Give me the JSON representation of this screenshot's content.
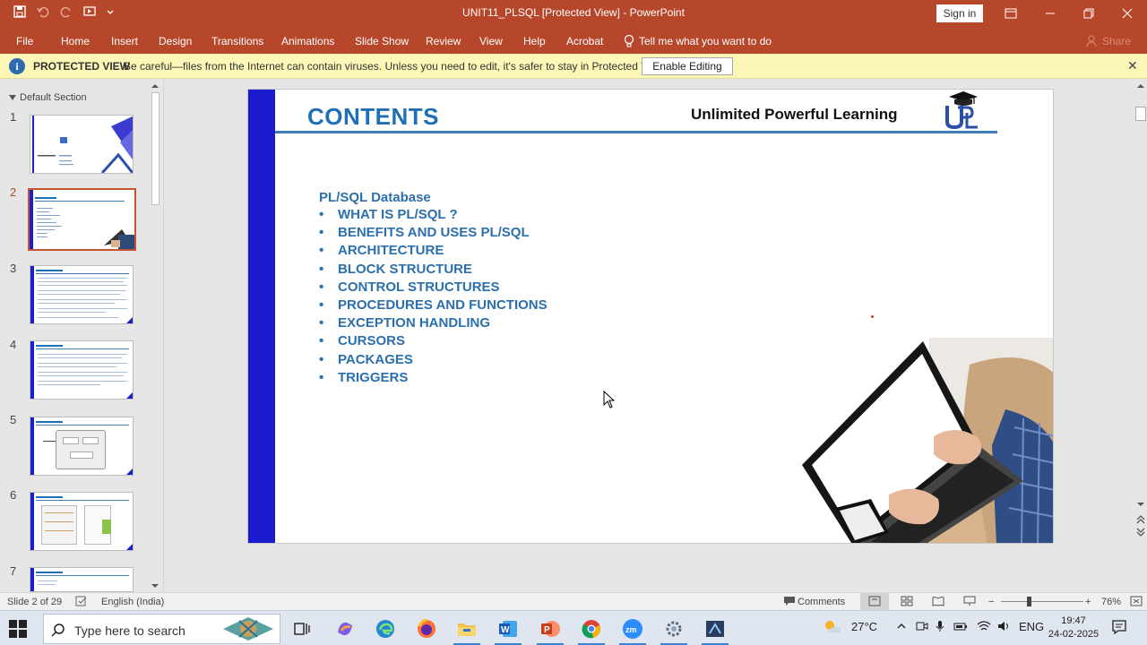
{
  "window": {
    "title": "UNIT11_PLSQL [Protected View]  -  PowerPoint",
    "signin_label": "Sign in"
  },
  "ribbon": {
    "tabs": [
      "File",
      "Home",
      "Insert",
      "Design",
      "Transitions",
      "Animations",
      "Slide Show",
      "Review",
      "View",
      "Help",
      "Acrobat"
    ],
    "tell_me": "Tell me what you want to do",
    "share": "Share"
  },
  "protected_view": {
    "title": "PROTECTED VIEW",
    "message": "Be careful—files from the Internet can contain viruses. Unless you need to edit, it's safer to stay in Protected View.",
    "enable_button": "Enable Editing"
  },
  "slides_pane": {
    "section_label": "Default Section",
    "slide_numbers": [
      "1",
      "2",
      "3",
      "4",
      "5",
      "6",
      "7"
    ],
    "active_slide": "2"
  },
  "slide": {
    "title": "CONTENTS",
    "brand": "Unlimited Powerful Learning",
    "heading": "PL/SQL Database",
    "items": [
      "WHAT IS PL/SQL ?",
      "BENEFITS AND USES PL/SQL",
      "ARCHITECTURE",
      "BLOCK STRUCTURE",
      "CONTROL STRUCTURES",
      "PROCEDURES AND FUNCTIONS",
      "EXCEPTION HANDLING",
      "CURSORS",
      "PACKAGES",
      "TRIGGERS"
    ],
    "bullet": "•"
  },
  "status": {
    "slide_counter": "Slide 2 of 29",
    "language": "English (India)",
    "comments": "Comments",
    "zoom": "76%"
  },
  "taskbar": {
    "search_placeholder": "Type here to search",
    "weather": "27°C",
    "lang": "ENG",
    "time": "19:47",
    "date": "24-02-2025"
  },
  "colors": {
    "accent": "#b7472a",
    "slide_bar": "#1a1acf",
    "slide_text": "#2b6fad"
  }
}
